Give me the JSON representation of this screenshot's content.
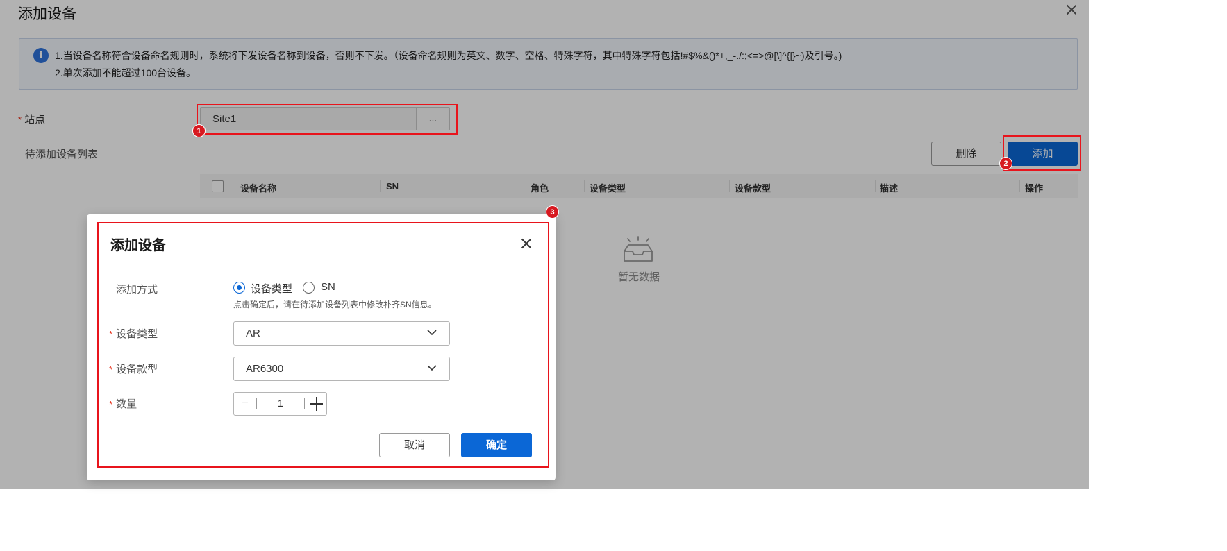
{
  "panel": {
    "title": "添加设备",
    "notice": {
      "line1": "1.当设备名称符合设备命名规则时，系统将下发设备名称到设备，否则不下发。（设备命名规则为英文、数字、空格、特殊字符，其中特殊字符包括!#$%&()*+,_-./:;<=>@[\\]^{|}~)及引号。)",
      "line2": "2.单次添加不能超过100台设备。"
    },
    "site": {
      "label": "站点",
      "value": "Site1",
      "browse_label": "..."
    },
    "list": {
      "label": "待添加设备列表",
      "delete_label": "删除",
      "add_label": "添加",
      "columns": [
        "设备名称",
        "SN",
        "角色",
        "设备类型",
        "设备款型",
        "描述",
        "操作"
      ],
      "empty_text": "暂无数据"
    }
  },
  "dialog": {
    "title": "添加设备",
    "method": {
      "label": "添加方式",
      "options": [
        "设备类型",
        "SN"
      ],
      "selected": "设备类型",
      "hint": "点击确定后，请在待添加设备列表中修改补齐SN信息。"
    },
    "device_type": {
      "label": "设备类型",
      "value": "AR"
    },
    "device_model": {
      "label": "设备款型",
      "value": "AR6300"
    },
    "quantity": {
      "label": "数量",
      "value": "1",
      "minus": "−"
    },
    "cancel_label": "取消",
    "ok_label": "确定"
  },
  "callouts": [
    "1",
    "2",
    "3"
  ],
  "colors": {
    "primary": "#0b67d6",
    "callout": "#e8141c",
    "required": "#e8341f"
  }
}
